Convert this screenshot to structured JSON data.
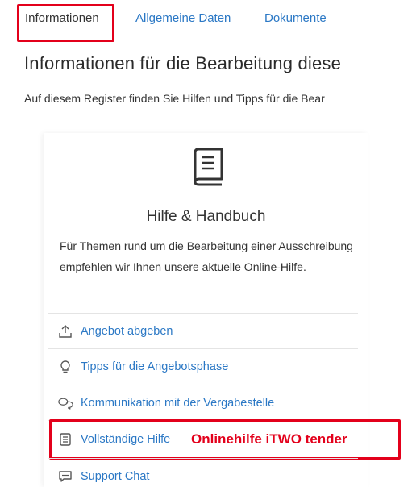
{
  "tabs": [
    {
      "label": "Informationen",
      "active": true
    },
    {
      "label": "Allgemeine Daten",
      "active": false
    },
    {
      "label": "Dokumente",
      "active": false
    }
  ],
  "header": {
    "title": "Informationen für die Bearbeitung diese",
    "subtitle": "Auf diesem Register finden Sie Hilfen und Tipps für die Bear"
  },
  "card": {
    "icon": "book-icon",
    "title": "Hilfe & Handbuch",
    "text": "Für Themen rund um die Bearbeitung einer Ausschreibung empfehlen wir Ihnen unsere aktuelle Online-Hilfe.",
    "links": [
      {
        "label": "Angebot abgeben",
        "icon": "upload-icon"
      },
      {
        "label": "Tipps für die Angebotsphase",
        "icon": "lightbulb-icon"
      },
      {
        "label": "Kommunikation mit der Vergabestelle",
        "icon": "chat-bubbles-icon"
      },
      {
        "label": "Vollständige Hilfe",
        "icon": "manual-icon"
      },
      {
        "label": "Support Chat",
        "icon": "chat-icon"
      }
    ]
  },
  "annotation": {
    "text": "Onlinehilfe iTWO tender"
  },
  "colors": {
    "link": "#2b78c5",
    "highlight": "#e3001b",
    "text": "#333333"
  }
}
